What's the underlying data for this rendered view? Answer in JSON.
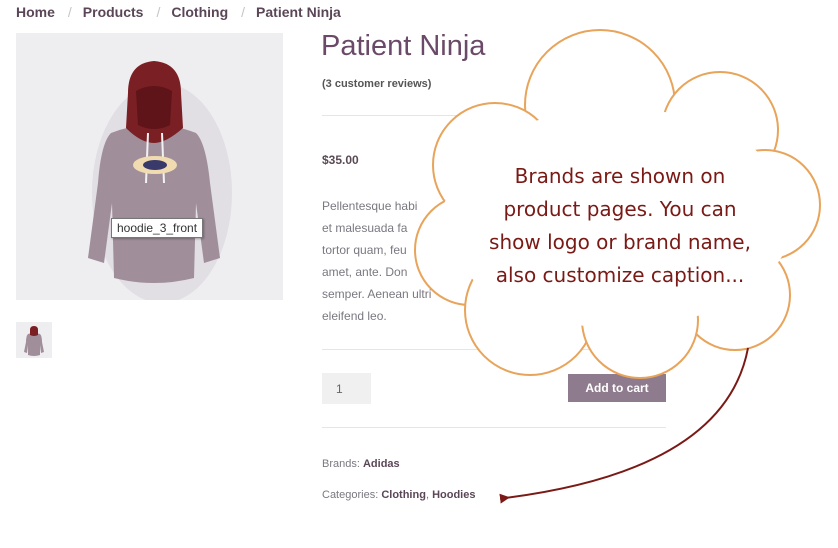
{
  "breadcrumb": {
    "items": [
      "Home",
      "Products",
      "Clothing",
      "Patient Ninja"
    ],
    "separator": "/"
  },
  "product": {
    "title": "Patient Ninja",
    "reviews": "(3 customer reviews)",
    "price": "$35.00",
    "description_lines": [
      "Pellentesque habi",
      "et malesuada fa",
      "tortor quam, feu",
      "amet, ante. Don",
      "semper. Aenean ultri",
      "eleifend leo."
    ],
    "image_tooltip": "hoodie_3_front",
    "quantity": "1",
    "add_to_cart_label": "Add to cart",
    "meta": {
      "brands_label": "Brands:",
      "brand": "Adidas",
      "categories_label": "Categories:",
      "categories": [
        "Clothing",
        "Hoodies"
      ],
      "categories_separator": ","
    }
  },
  "callout": {
    "lines": [
      "Brands are shown on",
      "product pages. You can",
      "show logo or brand name,",
      "also customize caption..."
    ]
  },
  "colors": {
    "accent": "#6b4a69",
    "button": "#8f7b8e",
    "callout_border": "#e8a45a",
    "callout_text": "#7a1a16",
    "arrow": "#7a1a16",
    "hoodie_body": "#9c8a96",
    "hoodie_hood": "#7a1f23"
  },
  "icons": {
    "hoodie_image": "hoodie-front-image",
    "thumbnail": "hoodie-thumbnail-image"
  }
}
